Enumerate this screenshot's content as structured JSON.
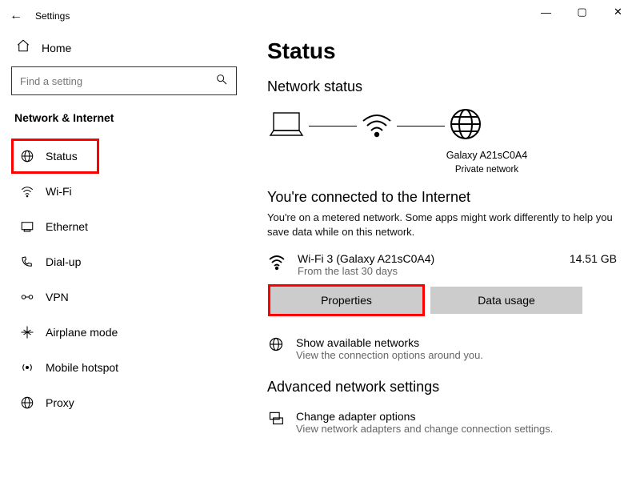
{
  "window": {
    "title": "Settings",
    "min": "—",
    "max": "▢",
    "close": "✕",
    "back": "←"
  },
  "sidebar": {
    "home_label": "Home",
    "search_placeholder": "Find a setting",
    "section_label": "Network & Internet",
    "items": [
      {
        "label": "Status"
      },
      {
        "label": "Wi-Fi"
      },
      {
        "label": "Ethernet"
      },
      {
        "label": "Dial-up"
      },
      {
        "label": "VPN"
      },
      {
        "label": "Airplane mode"
      },
      {
        "label": "Mobile hotspot"
      },
      {
        "label": "Proxy"
      }
    ]
  },
  "main": {
    "page_title": "Status",
    "section_title": "Network status",
    "device_name": "Galaxy A21sC0A4",
    "device_sub": "Private network",
    "connected_title": "You're connected to the Internet",
    "connected_desc": "You're on a metered network. Some apps might work differently to help you save data while on this network.",
    "wifi_name": "Wi-Fi 3 (Galaxy A21sC0A4)",
    "wifi_sub": "From the last 30 days",
    "wifi_data": "14.51 GB",
    "properties_btn": "Properties",
    "datausage_btn": "Data usage",
    "show_networks_title": "Show available networks",
    "show_networks_sub": "View the connection options around you.",
    "adv_title": "Advanced network settings",
    "adapter_title": "Change adapter options",
    "adapter_sub": "View network adapters and change connection settings."
  }
}
